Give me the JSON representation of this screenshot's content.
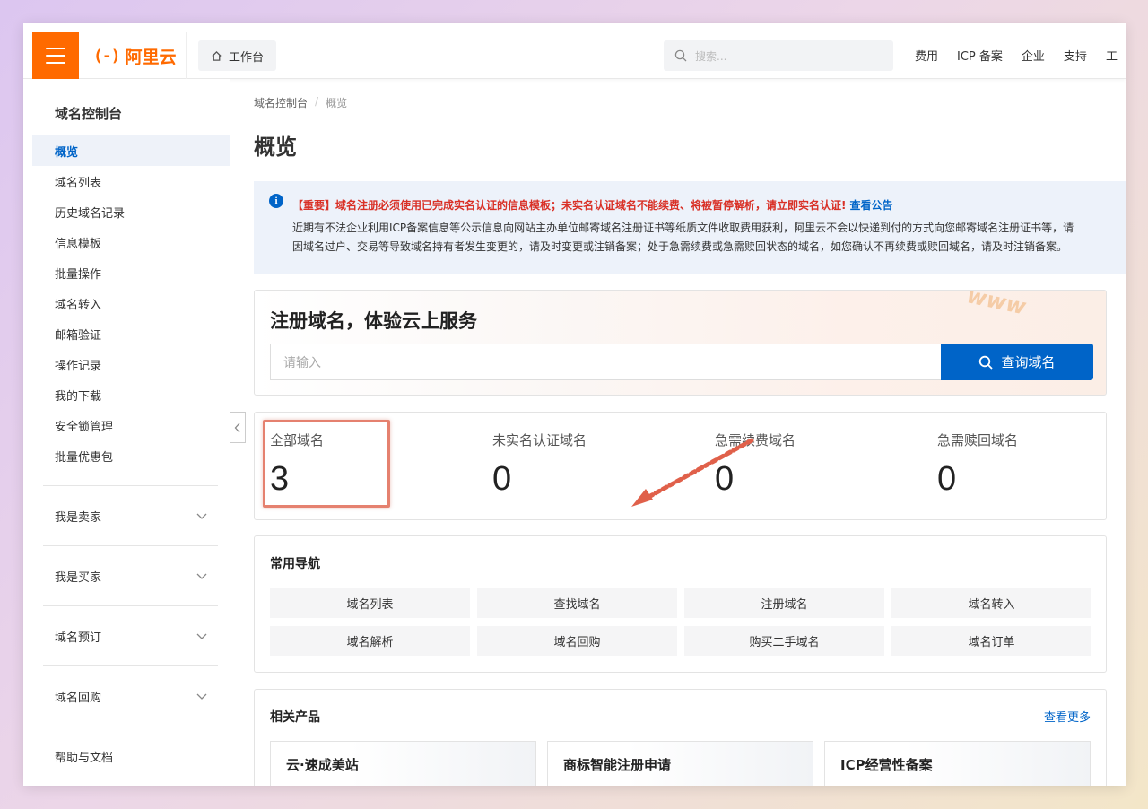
{
  "topbar": {
    "logo_mark": "(-)",
    "logo_text": "阿里云",
    "workbench": "工作台",
    "search_placeholder": "搜索...",
    "nav": [
      "费用",
      "ICP 备案",
      "企业",
      "支持",
      "工"
    ]
  },
  "sidebar": {
    "title": "域名控制台",
    "items": [
      {
        "label": "概览",
        "active": true
      },
      {
        "label": "域名列表"
      },
      {
        "label": "历史域名记录"
      },
      {
        "label": "信息模板"
      },
      {
        "label": "批量操作"
      },
      {
        "label": "域名转入"
      },
      {
        "label": "邮箱验证"
      },
      {
        "label": "操作记录"
      },
      {
        "label": "我的下载"
      },
      {
        "label": "安全锁管理"
      },
      {
        "label": "批量优惠包"
      }
    ],
    "groups": [
      "我是卖家",
      "我是买家",
      "域名预订",
      "域名回购"
    ],
    "footer": "帮助与文档"
  },
  "main": {
    "breadcrumb": [
      "域名控制台",
      "/",
      "概览"
    ],
    "title": "概览",
    "notice": {
      "head": "【重要】域名注册必须使用已完成实名认证的信息模板；未实名认证域名不能续费、将被暂停解析，请立即实名认证!",
      "link": "查看公告",
      "line1": "近期有不法企业利用ICP备案信息等公示信息向网站主办单位邮寄域名注册证书等纸质文件收取费用获利，阿里云不会以快递到付的方式向您邮寄域名注册证书等，请",
      "line2": "因域名过户、交易等导致域名持有者发生变更的，请及时变更或注销备案；处于急需续费或急需赎回状态的域名，如您确认不再续费或赎回域名，请及时注销备案。"
    },
    "register": {
      "title": "注册域名，体验云上服务",
      "placeholder": "请输入",
      "button": "查询域名",
      "deco": "www"
    },
    "stats": [
      {
        "label": "全部域名",
        "value": "3"
      },
      {
        "label": "未实名认证域名",
        "value": "0"
      },
      {
        "label": "急需续费域名",
        "value": "0"
      },
      {
        "label": "急需赎回域名",
        "value": "0"
      }
    ],
    "common_nav": {
      "title": "常用导航",
      "buttons": [
        "域名列表",
        "查找域名",
        "注册域名",
        "域名转入",
        "域名解析",
        "域名回购",
        "购买二手域名",
        "域名订单"
      ]
    },
    "products": {
      "title": "相关产品",
      "more": "查看更多",
      "items": [
        "云·速成美站",
        "商标智能注册申请",
        "ICP经营性备案"
      ]
    }
  },
  "colors": {
    "brand": "#ff6a00",
    "primary": "#0064c8",
    "notice_red": "#d93026",
    "highlight": "#e5816f"
  }
}
